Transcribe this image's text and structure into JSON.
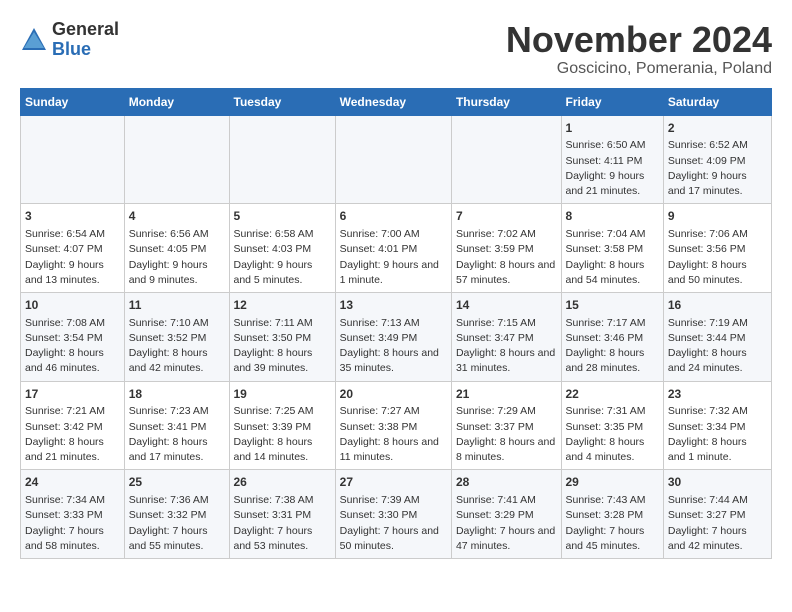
{
  "logo": {
    "general": "General",
    "blue": "Blue"
  },
  "title": "November 2024",
  "subtitle": "Goscicino, Pomerania, Poland",
  "weekdays": [
    "Sunday",
    "Monday",
    "Tuesday",
    "Wednesday",
    "Thursday",
    "Friday",
    "Saturday"
  ],
  "weeks": [
    [
      {
        "day": "",
        "info": ""
      },
      {
        "day": "",
        "info": ""
      },
      {
        "day": "",
        "info": ""
      },
      {
        "day": "",
        "info": ""
      },
      {
        "day": "",
        "info": ""
      },
      {
        "day": "1",
        "info": "Sunrise: 6:50 AM\nSunset: 4:11 PM\nDaylight: 9 hours and 21 minutes."
      },
      {
        "day": "2",
        "info": "Sunrise: 6:52 AM\nSunset: 4:09 PM\nDaylight: 9 hours and 17 minutes."
      }
    ],
    [
      {
        "day": "3",
        "info": "Sunrise: 6:54 AM\nSunset: 4:07 PM\nDaylight: 9 hours and 13 minutes."
      },
      {
        "day": "4",
        "info": "Sunrise: 6:56 AM\nSunset: 4:05 PM\nDaylight: 9 hours and 9 minutes."
      },
      {
        "day": "5",
        "info": "Sunrise: 6:58 AM\nSunset: 4:03 PM\nDaylight: 9 hours and 5 minutes."
      },
      {
        "day": "6",
        "info": "Sunrise: 7:00 AM\nSunset: 4:01 PM\nDaylight: 9 hours and 1 minute."
      },
      {
        "day": "7",
        "info": "Sunrise: 7:02 AM\nSunset: 3:59 PM\nDaylight: 8 hours and 57 minutes."
      },
      {
        "day": "8",
        "info": "Sunrise: 7:04 AM\nSunset: 3:58 PM\nDaylight: 8 hours and 54 minutes."
      },
      {
        "day": "9",
        "info": "Sunrise: 7:06 AM\nSunset: 3:56 PM\nDaylight: 8 hours and 50 minutes."
      }
    ],
    [
      {
        "day": "10",
        "info": "Sunrise: 7:08 AM\nSunset: 3:54 PM\nDaylight: 8 hours and 46 minutes."
      },
      {
        "day": "11",
        "info": "Sunrise: 7:10 AM\nSunset: 3:52 PM\nDaylight: 8 hours and 42 minutes."
      },
      {
        "day": "12",
        "info": "Sunrise: 7:11 AM\nSunset: 3:50 PM\nDaylight: 8 hours and 39 minutes."
      },
      {
        "day": "13",
        "info": "Sunrise: 7:13 AM\nSunset: 3:49 PM\nDaylight: 8 hours and 35 minutes."
      },
      {
        "day": "14",
        "info": "Sunrise: 7:15 AM\nSunset: 3:47 PM\nDaylight: 8 hours and 31 minutes."
      },
      {
        "day": "15",
        "info": "Sunrise: 7:17 AM\nSunset: 3:46 PM\nDaylight: 8 hours and 28 minutes."
      },
      {
        "day": "16",
        "info": "Sunrise: 7:19 AM\nSunset: 3:44 PM\nDaylight: 8 hours and 24 minutes."
      }
    ],
    [
      {
        "day": "17",
        "info": "Sunrise: 7:21 AM\nSunset: 3:42 PM\nDaylight: 8 hours and 21 minutes."
      },
      {
        "day": "18",
        "info": "Sunrise: 7:23 AM\nSunset: 3:41 PM\nDaylight: 8 hours and 17 minutes."
      },
      {
        "day": "19",
        "info": "Sunrise: 7:25 AM\nSunset: 3:39 PM\nDaylight: 8 hours and 14 minutes."
      },
      {
        "day": "20",
        "info": "Sunrise: 7:27 AM\nSunset: 3:38 PM\nDaylight: 8 hours and 11 minutes."
      },
      {
        "day": "21",
        "info": "Sunrise: 7:29 AM\nSunset: 3:37 PM\nDaylight: 8 hours and 8 minutes."
      },
      {
        "day": "22",
        "info": "Sunrise: 7:31 AM\nSunset: 3:35 PM\nDaylight: 8 hours and 4 minutes."
      },
      {
        "day": "23",
        "info": "Sunrise: 7:32 AM\nSunset: 3:34 PM\nDaylight: 8 hours and 1 minute."
      }
    ],
    [
      {
        "day": "24",
        "info": "Sunrise: 7:34 AM\nSunset: 3:33 PM\nDaylight: 7 hours and 58 minutes."
      },
      {
        "day": "25",
        "info": "Sunrise: 7:36 AM\nSunset: 3:32 PM\nDaylight: 7 hours and 55 minutes."
      },
      {
        "day": "26",
        "info": "Sunrise: 7:38 AM\nSunset: 3:31 PM\nDaylight: 7 hours and 53 minutes."
      },
      {
        "day": "27",
        "info": "Sunrise: 7:39 AM\nSunset: 3:30 PM\nDaylight: 7 hours and 50 minutes."
      },
      {
        "day": "28",
        "info": "Sunrise: 7:41 AM\nSunset: 3:29 PM\nDaylight: 7 hours and 47 minutes."
      },
      {
        "day": "29",
        "info": "Sunrise: 7:43 AM\nSunset: 3:28 PM\nDaylight: 7 hours and 45 minutes."
      },
      {
        "day": "30",
        "info": "Sunrise: 7:44 AM\nSunset: 3:27 PM\nDaylight: 7 hours and 42 minutes."
      }
    ]
  ]
}
